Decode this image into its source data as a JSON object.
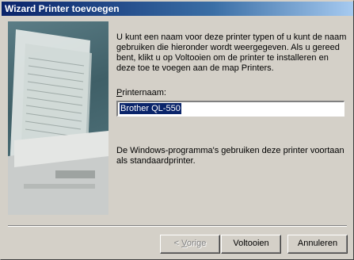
{
  "window": {
    "title": "Wizard Printer toevoegen"
  },
  "intro_text": "U kunt een naam voor deze printer typen of u kunt de naam gebruiken die hieronder wordt weergegeven. Als u gereed bent, klikt u op Voltooien om de printer te installeren en deze toe te voegen aan de map Printers.",
  "printer_name": {
    "label_first": "P",
    "label_rest": "rinternaam:",
    "value": "Brother QL-550"
  },
  "note_text": "De Windows-programma's gebruiken deze printer voortaan als standaardprinter.",
  "buttons": {
    "back_prefix": "< ",
    "back_accel": "V",
    "back_rest": "orige",
    "finish": "Voltooien",
    "cancel": "Annuleren"
  }
}
